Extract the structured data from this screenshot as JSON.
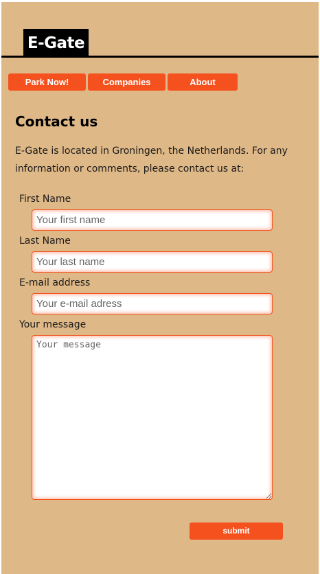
{
  "brand": {
    "logo_text": "E-Gate"
  },
  "nav": {
    "items": [
      {
        "label": "Park Now!"
      },
      {
        "label": "Companies"
      },
      {
        "label": "About"
      }
    ]
  },
  "main": {
    "title": "Contact us",
    "intro": "E-Gate is located in Groningen, the Netherlands. For any information or comments, please contact us at:"
  },
  "form": {
    "first_name": {
      "label": "First Name",
      "placeholder": "Your first name",
      "value": ""
    },
    "last_name": {
      "label": "Last Name",
      "placeholder": "Your last name",
      "value": ""
    },
    "email": {
      "label": "E-mail address",
      "placeholder": "Your e-mail adress",
      "value": ""
    },
    "message": {
      "label": "Your message",
      "placeholder": "Your message",
      "value": ""
    },
    "submit_label": "submit"
  },
  "colors": {
    "page_background": "#dfb887",
    "accent": "#f4511e",
    "logo_background": "#000000",
    "header_rule": "#000000"
  }
}
